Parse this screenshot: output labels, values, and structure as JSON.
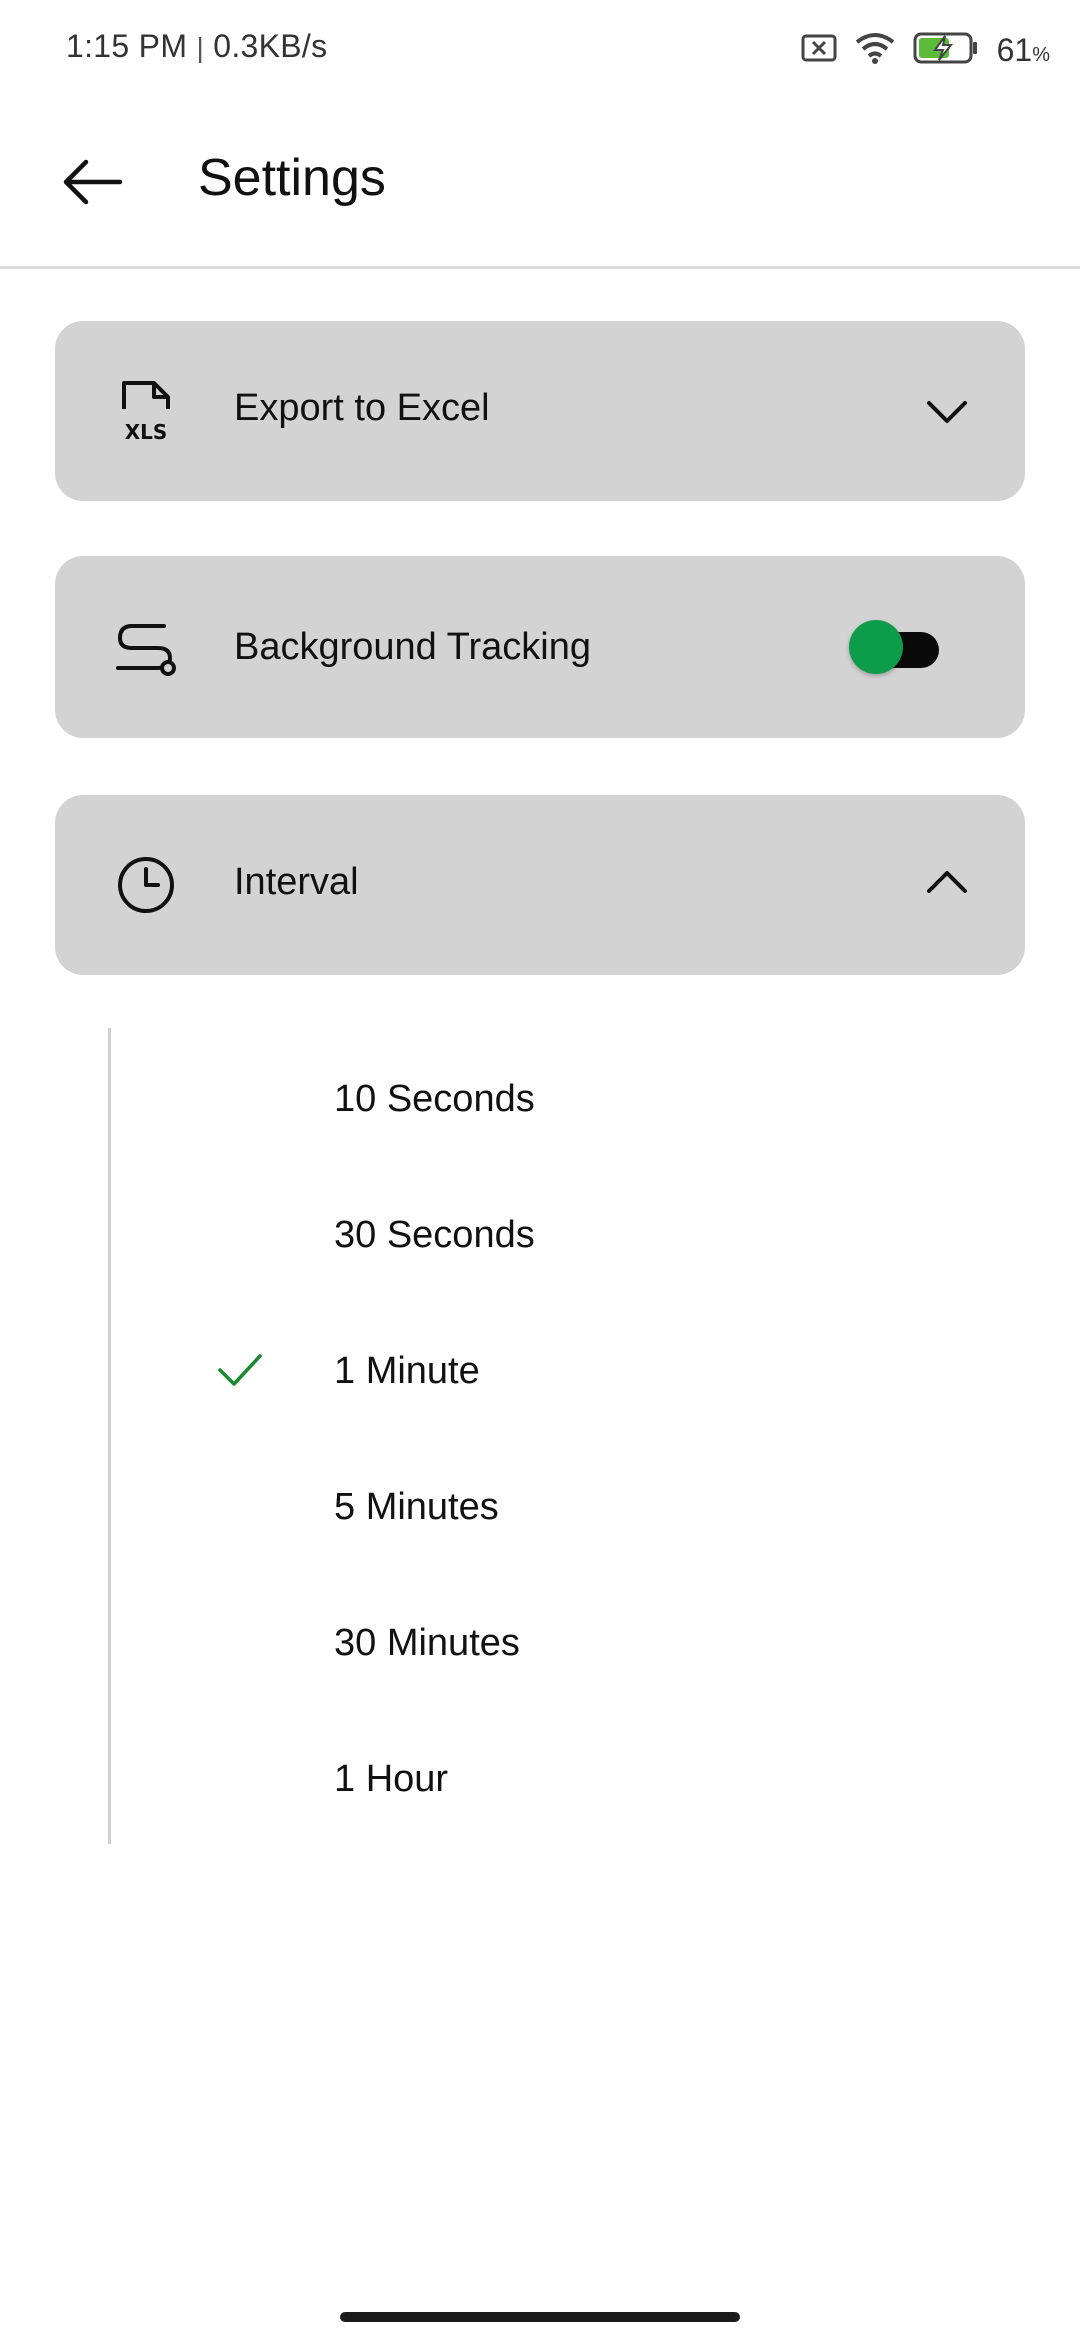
{
  "status_bar": {
    "time": "1:15 PM",
    "separator": "|",
    "speed": "0.3KB/s",
    "battery_percent": "61",
    "battery_unit": "%",
    "icons": [
      "sim-error-icon",
      "wifi-icon",
      "battery-charging-icon"
    ]
  },
  "app_bar": {
    "back_icon": "arrow-left-icon",
    "title": "Settings"
  },
  "cards": {
    "export": {
      "label": "Export to Excel",
      "icon": "xls-file-icon",
      "chevron": "chevron-down-icon"
    },
    "tracking": {
      "label": "Background Tracking",
      "icon": "route-icon",
      "enabled": true
    },
    "interval": {
      "label": "Interval",
      "icon": "clock-icon",
      "chevron": "chevron-up-icon"
    }
  },
  "interval_options": [
    {
      "label": "10 Seconds",
      "selected": false
    },
    {
      "label": "30 Seconds",
      "selected": false
    },
    {
      "label": "1 Minute",
      "selected": true
    },
    {
      "label": "5 Minutes",
      "selected": false
    },
    {
      "label": "30 Minutes",
      "selected": false
    },
    {
      "label": "1 Hour",
      "selected": false
    }
  ],
  "colors": {
    "accent_green": "#0d9c4a",
    "check_green": "#1a8a2e",
    "card_bg": "#d3d3d3"
  }
}
